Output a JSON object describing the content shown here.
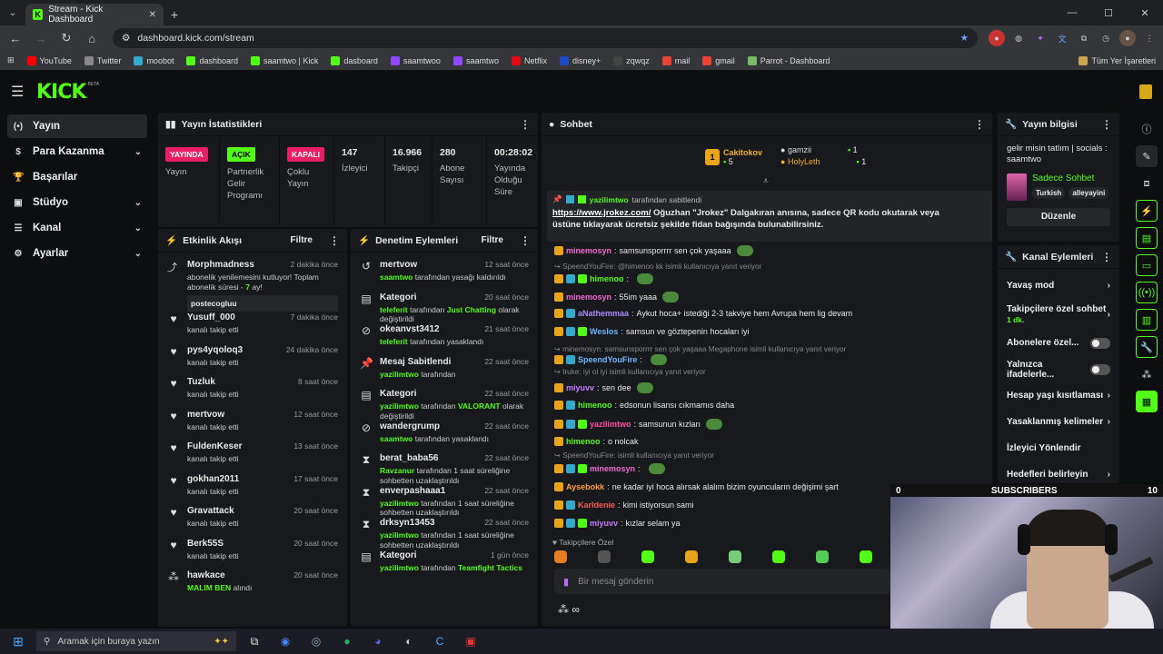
{
  "browser": {
    "tab_title": "Stream - Kick Dashboard",
    "url": "dashboard.kick.com/stream",
    "bookmarks": [
      {
        "label": "YouTube",
        "color": "#ff0000"
      },
      {
        "label": "Twitter",
        "color": "#888888"
      },
      {
        "label": "moobot",
        "color": "#3ac"
      },
      {
        "label": "dashboard",
        "color": "#53fc18"
      },
      {
        "label": "saamtwo | Kick",
        "color": "#53fc18"
      },
      {
        "label": "dasboard",
        "color": "#53fc18"
      },
      {
        "label": "saamtwoo",
        "color": "#9146ff"
      },
      {
        "label": "saamtwo",
        "color": "#9146ff"
      },
      {
        "label": "Netflix",
        "color": "#e50914"
      },
      {
        "label": "disney+",
        "color": "#1a4bc4"
      },
      {
        "label": "zqwqz",
        "color": "#444"
      },
      {
        "label": "mail",
        "color": "#ea4335"
      },
      {
        "label": "gmail",
        "color": "#ea4335"
      },
      {
        "label": "Parrot - Dashboard",
        "color": "#7b6"
      }
    ],
    "bookmarks_all": "Tüm Yer İşaretleri"
  },
  "logo": {
    "text": "KICK",
    "beta": "BETA"
  },
  "sidenav": [
    {
      "label": "Yayın",
      "icon": "(•)",
      "active": true,
      "chevron": false
    },
    {
      "label": "Para Kazanma",
      "icon": "$",
      "active": false,
      "chevron": true
    },
    {
      "label": "Başarılar",
      "icon": "🏆",
      "active": false,
      "chevron": false
    },
    {
      "label": "Stüdyo",
      "icon": "▣",
      "active": false,
      "chevron": true
    },
    {
      "label": "Kanal",
      "icon": "☰",
      "active": false,
      "chevron": true
    },
    {
      "label": "Ayarlar",
      "icon": "⚙",
      "active": false,
      "chevron": true
    }
  ],
  "stats": {
    "title": "Yayın İstatistikleri",
    "cells": [
      {
        "pill": "YAYINDA",
        "pill_bg": "#e91e63",
        "pill_fg": "#ffffff",
        "label": "Yayın"
      },
      {
        "pill": "AÇIK",
        "pill_bg": "#53fc18",
        "pill_fg": "#000000",
        "label": "Partnerlik Gelir Programı"
      },
      {
        "pill": "KAPALI",
        "pill_bg": "#e91e63",
        "pill_fg": "#ffffff",
        "label": "Çoklu Yayın"
      },
      {
        "num": "147",
        "label": "İzleyici"
      },
      {
        "num": "16.966",
        "label": "Takipçi"
      },
      {
        "num": "280",
        "label": "Abone Sayısı"
      },
      {
        "num": "00:28:02",
        "label": "Yayında Olduğu Süre"
      }
    ]
  },
  "activity": {
    "title": "Etkinlik Akışı",
    "filter": "Filtre",
    "top_item": {
      "name": "Morphmadness",
      "time": "2 dakika önce",
      "line1": "abonelik yenilemesini kutluyor! Toplam abonelik süresi - ",
      "months": "7",
      "line2": " ay!",
      "user": "postecogluu"
    },
    "items": [
      {
        "name": "Yusuff_000",
        "time": "7 dakika önce",
        "text": "kanalı takip etti"
      },
      {
        "name": "pys4yqoloq3",
        "time": "24 dakika önce",
        "text": "kanalı takip etti"
      },
      {
        "name": "Tuzluk",
        "time": "8 saat önce",
        "text": "kanalı takip etti"
      },
      {
        "name": "mertvow",
        "time": "12 saat önce",
        "text": "kanalı takip etti"
      },
      {
        "name": "FuldenKeser",
        "time": "13 saat önce",
        "text": "kanalı takip etti"
      },
      {
        "name": "gokhan2011",
        "time": "17 saat önce",
        "text": "kanalı takip etti"
      },
      {
        "name": "Gravattack",
        "time": "20 saat önce",
        "text": "kanalı takip etti"
      },
      {
        "name": "Berk55S",
        "time": "20 saat önce",
        "text": "kanalı takip etti"
      },
      {
        "name": "hawkace",
        "time": "20 saat önce",
        "hl": "MALIM BEN",
        "text": " alındı"
      }
    ]
  },
  "moderation": {
    "title": "Denetim Eylemleri",
    "filter": "Filtre",
    "items": [
      {
        "icon": "↺",
        "name": "mertvow",
        "time": "12 saat önce",
        "hl": "saamtwo",
        "text": " tarafından yasağı kaldırıldı"
      },
      {
        "icon": "▤",
        "name": "Kategori",
        "time": "20 saat önce",
        "hl": "teleferit",
        "text": " tarafından ",
        "hl2": "Just Chatting",
        "text2": " olarak değiştirildi"
      },
      {
        "icon": "⊘",
        "name": "okeanvst3412",
        "time": "21 saat önce",
        "hl": "teleferit",
        "text": " tarafından yasaklandı"
      },
      {
        "icon": "📌",
        "name": "Mesaj Sabitlendi",
        "time": "22 saat önce",
        "hl": "yazilimtwo",
        "text": " tarafından"
      },
      {
        "icon": "▤",
        "name": "Kategori",
        "time": "22 saat önce",
        "hl": "yazilimtwo",
        "text": " tarafından ",
        "hl2": "VALORANT",
        "text2": " olarak değiştirildi"
      },
      {
        "icon": "⊘",
        "name": "wandergrump",
        "time": "22 saat önce",
        "hl": "saamtwo",
        "text": " tarafından yasaklandı"
      },
      {
        "icon": "⧗",
        "name": "berat_baba56",
        "time": "22 saat önce",
        "hl": "Ravzanur",
        "text": " tarafından 1 saat süreliğine sohbetten uzaklaştırıldı"
      },
      {
        "icon": "⧗",
        "name": "enverpashaaa1",
        "time": "22 saat önce",
        "hl": "yazilimtwo",
        "text": " tarafından 1 saat süreliğine sohbetten uzaklaştırıldı"
      },
      {
        "icon": "⧗",
        "name": "drksyn13453",
        "time": "22 saat önce",
        "hl": "yazilimtwo",
        "text": " tarafından 1 saat süreliğine sohbetten uzaklaştırıldı"
      },
      {
        "icon": "▤",
        "name": "Kategori",
        "time": "1 gün önce",
        "hl": "yazilimtwo",
        "text": " tarafından ",
        "hl2": "Teamfight Tactics",
        "text2": ""
      }
    ]
  },
  "chat": {
    "title": "Sohbet",
    "leader": {
      "rank": "1",
      "name": "Cakitokov",
      "count": "5"
    },
    "others": [
      {
        "name": "gamzii",
        "count": "1"
      },
      {
        "name": "HolyLeth",
        "count": "1"
      }
    ],
    "pinned": {
      "by": "yazilimtwo",
      "by_suffix": " tarafından sabitlendi",
      "link": "https://www.jrokez.com/",
      "text": " Oğuzhan \"Jrokez\" Dalgakıran anısına, sadece QR kodu okutarak veya üstüne tıklayarak ücretsiz şekilde fidan bağışında bulunabilirsiniz."
    },
    "messages": [
      {
        "user": "minemosyn",
        "color": "#f06ad0",
        "text": "samsunsporrrr sen çok yaşaaa"
      },
      {
        "reply": "SpeendYouFire: @himenoo kk isimli kullanıcıya yanıt veriyor"
      },
      {
        "user": "himenoo",
        "color": "#53fc18",
        "text": ""
      },
      {
        "user": "minemosyn",
        "color": "#f06ad0",
        "text": "55im yaaa"
      },
      {
        "user": "aNathemmaa",
        "color": "#a98bff",
        "text": "Aykut hoca+ istediği 2-3 takviye hem Avrupa hem lig devam"
      },
      {
        "user": "Weslos",
        "color": "#6fb8ff",
        "text": "samsun ve göztepenin hocaları iyi"
      },
      {
        "reply": "minemosyn: samsunsporrrr sen çok yaşaaa Megaphone isimli kullanıcıya yanıt veriyor"
      },
      {
        "user": "SpeendYouFire",
        "color": "#6fb8ff",
        "text": ""
      },
      {
        "reply": "Iruke: iyi ol iyi isimli kullanıcıya yanıt veriyor"
      },
      {
        "user": "miyuvv",
        "color": "#c77dff",
        "text": "sen dee"
      },
      {
        "user": "himenoo",
        "color": "#53fc18",
        "text": "edsonun lisansı cıkmamıs daha"
      },
      {
        "user": "yazilimtwo",
        "color": "#ff4fa0",
        "text": "samsunun kızları"
      },
      {
        "user": "himenoo",
        "color": "#53fc18",
        "text": "o nolcak"
      },
      {
        "reply": "SpeendYouFire: isimli kullanıcıya yanıt veriyor"
      },
      {
        "user": "minemosyn",
        "color": "#f06ad0",
        "text": ""
      },
      {
        "user": "Aysebokk",
        "color": "#ff9f43",
        "text": "ne kadar iyi hoca alırsak alalım bizim oyuncuların değişimi şart"
      },
      {
        "user": "Karldenie",
        "color": "#ff5a5a",
        "text": "kimi istiyorsun sami"
      },
      {
        "user": "miyuvv",
        "color": "#c77dff",
        "text": "kızlar selam ya"
      }
    ],
    "emote_label": "Takipçilere Özel",
    "input_placeholder": "Bir mesaj gönderin"
  },
  "streaminfo": {
    "title": "Yayın bilgisi",
    "stream_title": "gelir misin tatlım | socials : saamtwo",
    "category": "Sadece Sohbet",
    "tags": [
      "Turkish",
      "alleyayini"
    ],
    "edit": "Düzenle"
  },
  "channelactions": {
    "title": "Kanal Eylemleri",
    "items": [
      {
        "label": "Yavaş mod",
        "type": "chev"
      },
      {
        "label": "Takipçilere özel sohbet",
        "sub": "1 dk.",
        "type": "chev"
      },
      {
        "label": "Abonelere özel...",
        "type": "toggle"
      },
      {
        "label": "Yalnızca ifadelerle...",
        "type": "toggle"
      },
      {
        "label": "Hesap yaşı kısıtlaması",
        "type": "chev"
      },
      {
        "label": "Yasaklanmış kelimeler",
        "type": "chev"
      },
      {
        "label": "İzleyici Yönlendir",
        "type": "none"
      },
      {
        "label": "Hedefleri belirleyin",
        "type": "chev"
      }
    ]
  },
  "webcam": {
    "left": "0",
    "label": "SUBSCRIBERS",
    "right": "10"
  },
  "taskbar": {
    "search": "Aramak için buraya yazın"
  },
  "colors": {
    "accent": "#53fc18",
    "live": "#e91e63",
    "panel": "#18191c"
  }
}
